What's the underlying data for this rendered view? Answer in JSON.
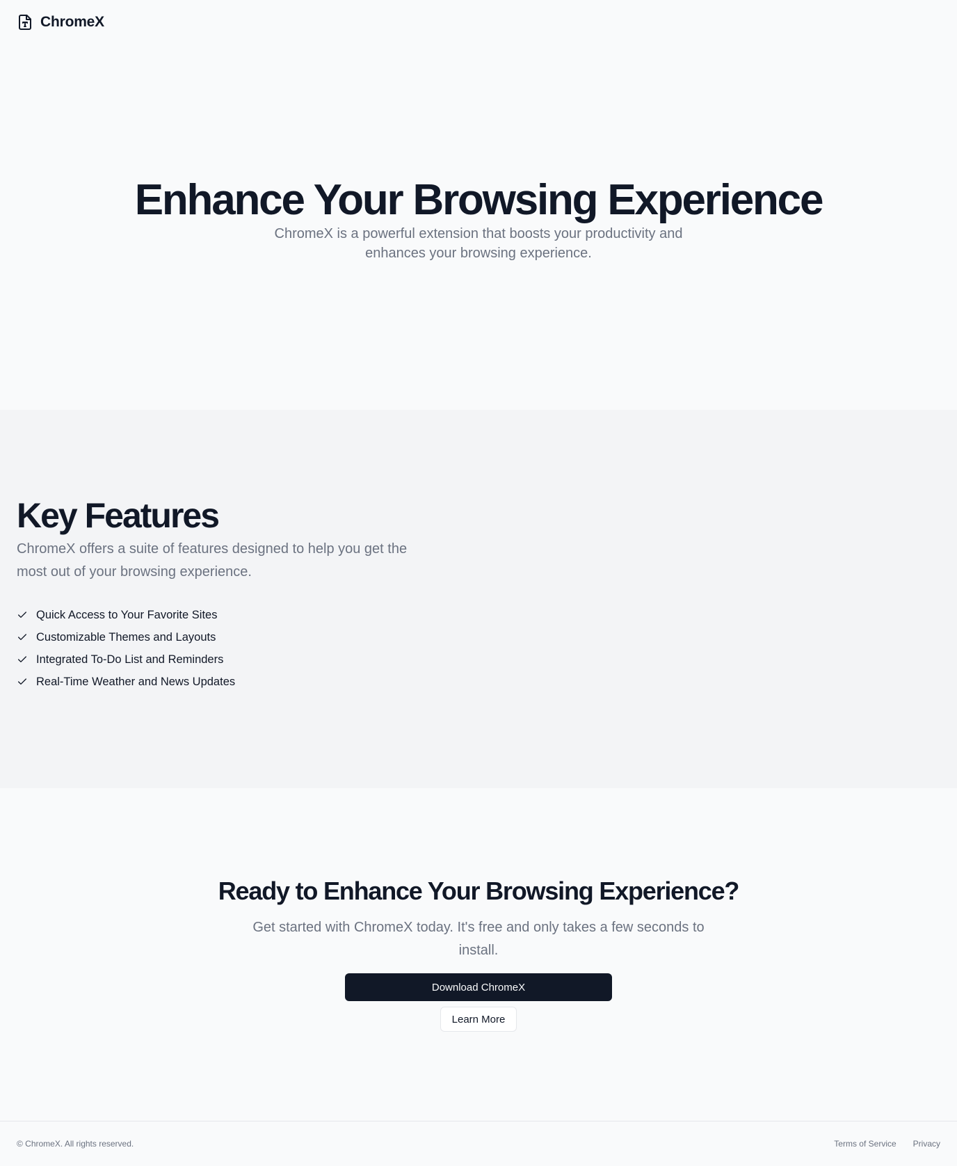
{
  "header": {
    "brand_name": "ChromeX",
    "brand_icon": "file-type-icon"
  },
  "hero": {
    "title": "Enhance Your Browsing Experience",
    "subtitle": "ChromeX is a powerful extension that boosts your productivity and enhances your browsing experience."
  },
  "features": {
    "title": "Key Features",
    "subtitle": "ChromeX offers a suite of features designed to help you get the most out of your browsing experience.",
    "items": [
      {
        "label": "Quick Access to Your Favorite Sites",
        "icon": "check-icon"
      },
      {
        "label": "Customizable Themes and Layouts",
        "icon": "check-icon"
      },
      {
        "label": "Integrated To-Do List and Reminders",
        "icon": "check-icon"
      },
      {
        "label": "Real-Time Weather and News Updates",
        "icon": "check-icon"
      }
    ]
  },
  "cta": {
    "title": "Ready to Enhance Your Browsing Experience?",
    "subtitle": "Get started with ChromeX today. It's free and only takes a few seconds to install.",
    "primary_label": "Download ChromeX",
    "secondary_label": "Learn More"
  },
  "footer": {
    "copyright": "© ChromeX. All rights reserved.",
    "links": [
      {
        "label": "Terms of Service"
      },
      {
        "label": "Privacy"
      }
    ]
  },
  "colors": {
    "background": "#f9fafb",
    "section_alt": "#f3f4f6",
    "text_primary": "#111827",
    "text_muted": "#6b7280",
    "button_dark": "#111827",
    "border": "#e5e7eb"
  }
}
